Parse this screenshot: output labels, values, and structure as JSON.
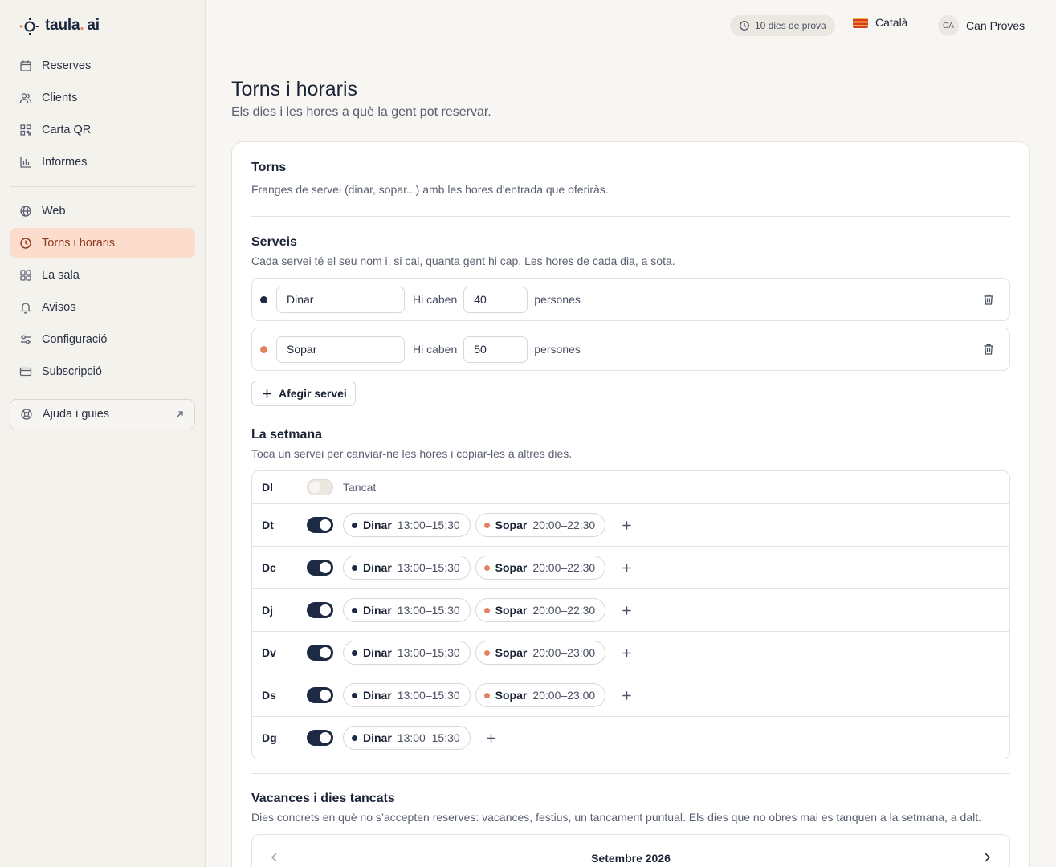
{
  "brand": {
    "name_main": "taula",
    "name_dot": ".",
    "name_tld": "ai"
  },
  "nav": {
    "primary": [
      {
        "label": "Reserves",
        "icon": "calendar-icon"
      },
      {
        "label": "Clients",
        "icon": "users-icon"
      },
      {
        "label": "Carta QR",
        "icon": "qr-icon"
      },
      {
        "label": "Informes",
        "icon": "chart-icon"
      }
    ],
    "secondary": [
      {
        "label": "Web",
        "icon": "globe-icon"
      },
      {
        "label": "Torns i horaris",
        "icon": "clock-icon",
        "active": true
      },
      {
        "label": "La sala",
        "icon": "grid-icon"
      },
      {
        "label": "Avisos",
        "icon": "bell-icon"
      },
      {
        "label": "Configuració",
        "icon": "sliders-icon"
      },
      {
        "label": "Subscripció",
        "icon": "card-icon"
      }
    ],
    "help": "Ajuda i guies"
  },
  "topbar": {
    "trial": "10 dies de prova",
    "language": "Català",
    "avatar_initials": "CA",
    "user_name": "Can Proves"
  },
  "page": {
    "title": "Torns i horaris",
    "subtitle": "Els dies i les hores a què la gent pot reservar."
  },
  "torns": {
    "title": "Torns",
    "description": "Franges de servei (dinar, sopar...) amb les hores d'entrada que oferiràs."
  },
  "serveis": {
    "title": "Serveis",
    "description": "Cada servei té el seu nom i, si cal, quanta gent hi cap. Les hores de cada dia, a sota.",
    "capacity_label": "Hi caben",
    "capacity_unit": "persones",
    "items": [
      {
        "name": "Dinar",
        "capacity": "40",
        "color": "#1d2a44"
      },
      {
        "name": "Sopar",
        "capacity": "50",
        "color": "#e2825f"
      }
    ],
    "add_label": "Afegir servei"
  },
  "setmana": {
    "title": "La setmana",
    "description": "Toca un servei per canviar-ne les hores i copiar-les a altres dies.",
    "closed_label": "Tancat",
    "days": [
      {
        "name": "Dl",
        "open": false,
        "slots": []
      },
      {
        "name": "Dt",
        "open": true,
        "slots": [
          {
            "service": "Dinar",
            "time": "13:00–15:30"
          },
          {
            "service": "Sopar",
            "time": "20:00–22:30"
          }
        ]
      },
      {
        "name": "Dc",
        "open": true,
        "slots": [
          {
            "service": "Dinar",
            "time": "13:00–15:30"
          },
          {
            "service": "Sopar",
            "time": "20:00–22:30"
          }
        ]
      },
      {
        "name": "Dj",
        "open": true,
        "slots": [
          {
            "service": "Dinar",
            "time": "13:00–15:30"
          },
          {
            "service": "Sopar",
            "time": "20:00–22:30"
          }
        ]
      },
      {
        "name": "Dv",
        "open": true,
        "slots": [
          {
            "service": "Dinar",
            "time": "13:00–15:30"
          },
          {
            "service": "Sopar",
            "time": "20:00–23:00"
          }
        ]
      },
      {
        "name": "Ds",
        "open": true,
        "slots": [
          {
            "service": "Dinar",
            "time": "13:00–15:30"
          },
          {
            "service": "Sopar",
            "time": "20:00–23:00"
          }
        ]
      },
      {
        "name": "Dg",
        "open": true,
        "slots": [
          {
            "service": "Dinar",
            "time": "13:00–15:30"
          }
        ]
      }
    ]
  },
  "vacances": {
    "title": "Vacances i dies tancats",
    "description": "Dies concrets en què no s’accepten reserves: vacances, festius, un tancament puntual. Els dies que no obres mai es tanquen a la setmana, a dalt.",
    "month": "Setembre 2026"
  },
  "colors": {
    "accent": "#e2825f",
    "navy": "#1d2a44",
    "active_bg": "#fbdccd"
  }
}
